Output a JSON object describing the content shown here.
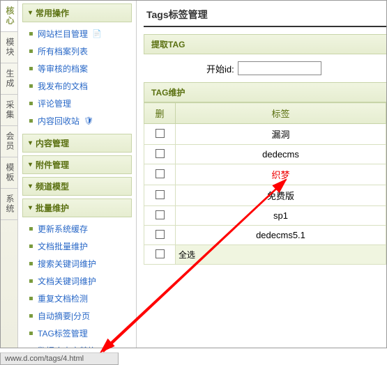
{
  "leftTabs": [
    "核心",
    "模块",
    "生成",
    "采集",
    "会员",
    "模板",
    "系统"
  ],
  "activeTab": 0,
  "sidebar": {
    "sections": [
      {
        "title": "常用操作",
        "items": [
          "网站栏目管理",
          "所有档案列表",
          "等审核的档案",
          "我发布的文档",
          "评论管理",
          "内容回收站"
        ],
        "icons": {
          "0": "📄",
          "5": "🛡"
        }
      },
      {
        "title": "内容管理",
        "items": []
      },
      {
        "title": "附件管理",
        "items": []
      },
      {
        "title": "频道模型",
        "items": []
      },
      {
        "title": "批量维护",
        "items": [
          "更新系统缓存",
          "文档批量维护",
          "搜索关键词维护",
          "文档关键词维护",
          "重复文档检测",
          "自动摘要|分页",
          "TAG标签管理",
          "数据库内容替换"
        ]
      }
    ]
  },
  "main": {
    "title": "Tags标签管理",
    "panel1": "提取TAG",
    "startIdLabel": "开始id:",
    "startIdValue": "",
    "panel2": "TAG维护",
    "cols": {
      "del": "删",
      "tag": "标签"
    },
    "rows": [
      {
        "tag": "漏洞"
      },
      {
        "tag": "dedecms"
      },
      {
        "tag": "织梦",
        "red": true
      },
      {
        "tag": "免费版"
      },
      {
        "tag": "sp1"
      },
      {
        "tag": "dedecms5.1"
      }
    ],
    "selectAll": "全选"
  },
  "statusBar": "www.d.com/tags/4.html"
}
